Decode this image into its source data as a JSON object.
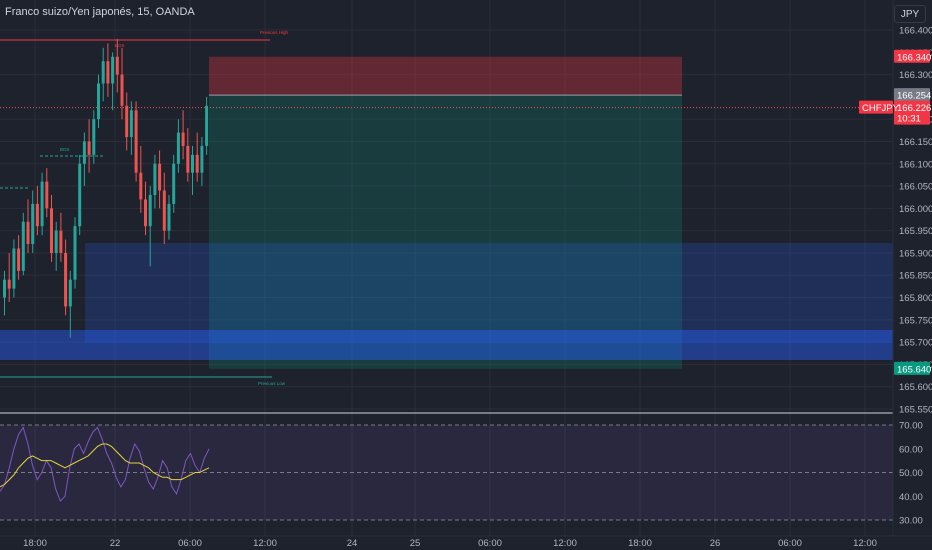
{
  "header": {
    "title": "Franco suizo/Yen japonés, 15, OANDA",
    "currency_button": "JPY"
  },
  "colors": {
    "background": "#1e222d",
    "up_candle": "#26a69a",
    "down_candle": "#ef5350",
    "rsi_line": "#7e57c2",
    "rsi_ma": "#e6d43a",
    "stop_zone": "#f23645",
    "target_zone": "#089981",
    "demand_zone": "#2962ff"
  },
  "chart_data": {
    "type": "candlestick",
    "symbol": "CHFJPY",
    "timeframe": "15",
    "y_axis": {
      "ticks": [
        "166.400",
        "166.300",
        "166.200",
        "166.150",
        "166.100",
        "166.050",
        "166.000",
        "165.950",
        "165.900",
        "165.850",
        "165.800",
        "165.750",
        "165.700",
        "165.650",
        "165.600",
        "165.550"
      ],
      "partial_top_tick": "166.350",
      "range": [
        165.55,
        166.43
      ]
    },
    "x_axis": {
      "ticks": [
        "18:00",
        "22",
        "06:00",
        "12:00",
        "24",
        "25",
        "06:00",
        "12:00",
        "18:00",
        "26",
        "06:00",
        "12:00"
      ]
    },
    "price_tags": {
      "stop_level": "166.340",
      "entry_level": "166.254",
      "last_symbol": "CHFJPY",
      "last_price": "166.226",
      "countdown": "10:31",
      "target_level": "165.640"
    },
    "annotations": {
      "top_line_label": "Previous High",
      "peak_label": "BOS",
      "mid_label": "BOS",
      "bottom_line_label": "Previous Low"
    },
    "candles_ohlc": [
      [
        165.8,
        165.86,
        165.76,
        165.84
      ],
      [
        165.84,
        165.9,
        165.79,
        165.82
      ],
      [
        165.82,
        165.93,
        165.8,
        165.91
      ],
      [
        165.91,
        165.94,
        165.84,
        165.86
      ],
      [
        165.86,
        165.99,
        165.85,
        165.97
      ],
      [
        165.97,
        166.02,
        165.9,
        165.92
      ],
      [
        165.92,
        166.04,
        165.9,
        166.01
      ],
      [
        166.01,
        166.05,
        165.94,
        165.96
      ],
      [
        165.96,
        166.08,
        165.94,
        166.06
      ],
      [
        166.06,
        166.09,
        165.98,
        166.0
      ],
      [
        166.0,
        166.03,
        165.88,
        165.9
      ],
      [
        165.9,
        165.97,
        165.86,
        165.95
      ],
      [
        165.95,
        165.99,
        165.88,
        165.9
      ],
      [
        165.9,
        165.93,
        165.76,
        165.78
      ],
      [
        165.78,
        165.86,
        165.71,
        165.84
      ],
      [
        165.84,
        165.98,
        165.82,
        165.96
      ],
      [
        165.96,
        166.12,
        165.94,
        166.1
      ],
      [
        166.1,
        166.17,
        166.05,
        166.15
      ],
      [
        166.15,
        166.2,
        166.08,
        166.12
      ],
      [
        166.12,
        166.22,
        166.1,
        166.2
      ],
      [
        166.2,
        166.3,
        166.18,
        166.28
      ],
      [
        166.28,
        166.36,
        166.24,
        166.33
      ],
      [
        166.33,
        166.37,
        166.25,
        166.28
      ],
      [
        166.28,
        166.35,
        166.22,
        166.34
      ],
      [
        166.34,
        166.38,
        166.26,
        166.3
      ],
      [
        166.3,
        166.36,
        166.2,
        166.23
      ],
      [
        166.23,
        166.26,
        166.13,
        166.16
      ],
      [
        166.16,
        166.24,
        166.12,
        166.22
      ],
      [
        166.22,
        166.24,
        166.06,
        166.08
      ],
      [
        166.08,
        166.14,
        165.99,
        166.02
      ],
      [
        166.02,
        166.06,
        165.94,
        165.96
      ],
      [
        165.96,
        166.05,
        165.87,
        166.03
      ],
      [
        166.03,
        166.12,
        166.0,
        166.1
      ],
      [
        166.1,
        166.13,
        166.0,
        166.04
      ],
      [
        166.04,
        166.08,
        165.92,
        165.95
      ],
      [
        165.95,
        166.03,
        165.93,
        166.01
      ],
      [
        166.01,
        166.12,
        165.99,
        166.1
      ],
      [
        166.1,
        166.2,
        166.08,
        166.17
      ],
      [
        166.17,
        166.22,
        166.11,
        166.14
      ],
      [
        166.14,
        166.18,
        166.06,
        166.08
      ],
      [
        166.08,
        166.14,
        166.03,
        166.12
      ],
      [
        166.12,
        166.17,
        166.06,
        166.08
      ],
      [
        166.08,
        166.16,
        166.05,
        166.14
      ],
      [
        166.14,
        166.25,
        166.12,
        166.23
      ]
    ],
    "rsi": {
      "ticks": [
        "70.00",
        "60.00",
        "50.00",
        "40.00",
        "30.00"
      ],
      "range": [
        27,
        75
      ],
      "values": [
        42,
        45,
        52,
        60,
        66,
        69,
        62,
        53,
        47,
        50,
        55,
        52,
        43,
        38,
        40,
        52,
        60,
        62,
        58,
        63,
        67,
        69,
        64,
        58,
        54,
        48,
        44,
        47,
        56,
        62,
        59,
        52,
        46,
        43,
        48,
        55,
        52,
        44,
        41,
        47,
        55,
        58,
        53,
        50,
        56,
        60
      ],
      "ma": [
        44,
        45,
        47,
        49,
        52,
        54,
        56,
        57,
        56,
        55,
        55,
        55,
        54,
        53,
        52,
        53,
        54,
        55,
        56,
        57,
        59,
        61,
        62,
        62,
        61,
        59,
        57,
        55,
        54,
        54,
        54,
        53,
        52,
        50,
        49,
        48,
        48,
        47,
        47,
        47,
        48,
        49,
        50,
        50,
        51,
        52
      ]
    }
  }
}
